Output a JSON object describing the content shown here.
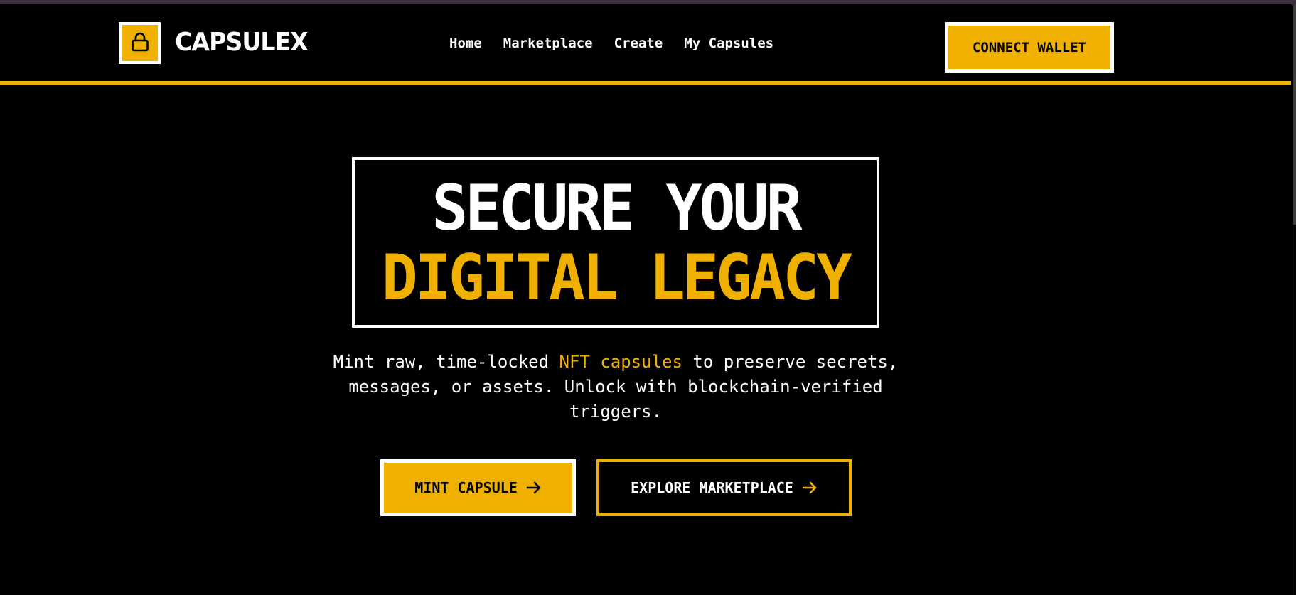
{
  "theme": {
    "accent": "#f0b000",
    "background": "#000000",
    "text": "#ffffff"
  },
  "header": {
    "logo_icon": "lock-icon",
    "brand": "CAPSULEX",
    "nav": [
      {
        "label": "Home"
      },
      {
        "label": "Marketplace"
      },
      {
        "label": "Create"
      },
      {
        "label": "My Capsules"
      }
    ],
    "connect_label": "CONNECT WALLET"
  },
  "hero": {
    "line1": "SECURE YOUR",
    "line2": "DIGITAL LEGACY",
    "tagline_before": "Mint raw, time-locked ",
    "tagline_highlight": "NFT capsules",
    "tagline_after": " to preserve secrets, messages, or assets. Unlock with blockchain-verified triggers.",
    "primary_button": "MINT CAPSULE",
    "primary_icon": "arrow-right-icon",
    "secondary_button": "EXPLORE MARKETPLACE",
    "secondary_icon": "arrow-right-icon"
  }
}
